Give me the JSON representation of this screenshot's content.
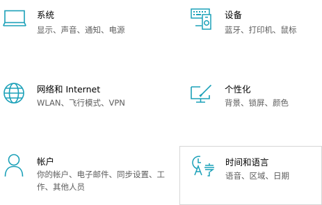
{
  "accent_color": "#1aa0b8",
  "settings": [
    {
      "id": "system",
      "icon": "monitor-icon",
      "title": "系统",
      "desc": "显示、声音、通知、电源"
    },
    {
      "id": "devices",
      "icon": "devices-icon",
      "title": "设备",
      "desc": "蓝牙、打印机、鼠标"
    },
    {
      "id": "network",
      "icon": "globe-icon",
      "title": "网络和 Internet",
      "desc": "WLAN、飞行模式、VPN"
    },
    {
      "id": "personalization",
      "icon": "paint-icon",
      "title": "个性化",
      "desc": "背景、锁屏、颜色"
    },
    {
      "id": "accounts",
      "icon": "person-icon",
      "title": "帐户",
      "desc": "你的帐户、电子邮件、同步设置、工作、其他人员"
    },
    {
      "id": "time",
      "icon": "time-language-icon",
      "title": "时间和语言",
      "desc": "语音、区域、日期"
    }
  ]
}
